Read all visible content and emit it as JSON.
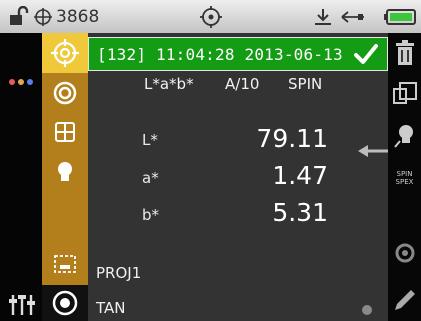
{
  "statusbar": {
    "battery_number": "3868"
  },
  "colors": {
    "gold": "#b37f1c",
    "header_green": "#149c14",
    "panel": "#333333"
  },
  "measurement": {
    "header": "[132] 11:04:28 2013-06-13",
    "mode": "L*a*b*",
    "illuminant": "A/10",
    "specular": "SPIN",
    "rows": [
      {
        "label": "L*",
        "value": "79.11"
      },
      {
        "label": "a*",
        "value": "1.47"
      },
      {
        "label": "b*",
        "value": "5.31"
      }
    ],
    "project": "PROJ1",
    "standard": "TAN"
  },
  "right_toolbar": {
    "spin_label_line1": "SPIN",
    "spin_label_line2": "SPEX"
  },
  "icons": [
    "lock-open-icon",
    "crosshair-icon",
    "target-icon",
    "usb-icon",
    "battery-icon",
    "check-icon",
    "trash-icon",
    "compare-icon",
    "bulb-icon",
    "arrow-left-icon",
    "sliders-icon"
  ]
}
